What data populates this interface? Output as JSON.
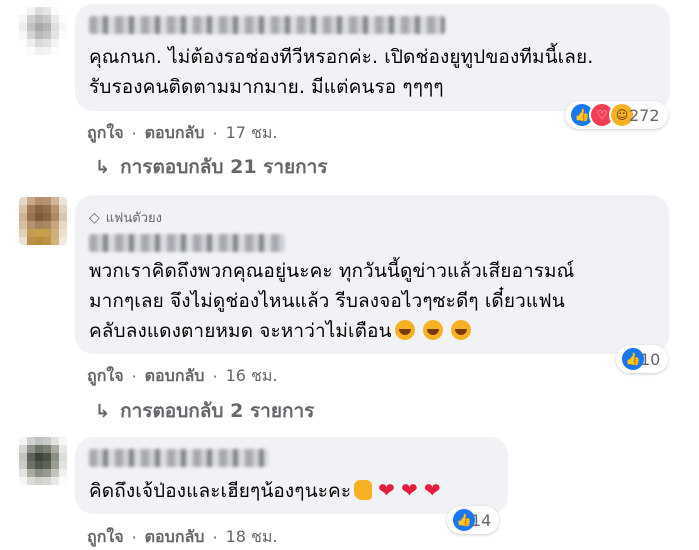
{
  "comments": [
    {
      "text": "คุณกนก. ไม่ต้องรอช่องทีวีหรอกค่ะ. เปิดช่องยูทูปของทีมนี้เลย.\nรับรองคนติดตามมากมาย. มีแต่คนรอ ๆๆๆๆ",
      "reactions": {
        "icons": [
          "like-icon",
          "love-icon",
          "haha-icon"
        ],
        "count": "272"
      },
      "like_label": "ถูกใจ",
      "reply_label": "ตอบกลับ",
      "time": "17 ชม.",
      "replies_label": "การตอบกลับ 21 รายการ"
    },
    {
      "badge": "แฟนตัวยง",
      "text": "พวกเราคิดถึงพวกคุณอยู่นะคะ ทุกวันนี้ดูข่าวแล้วเสียอารมณ์\nมากๆเลย จึงไม่ดูช่องไหนแล้ว รีบลงจอไวๆซะดีๆ เดี๋ยวแฟน\nคลับลงแดงตายหมด จะหาว่าไม่เตือน",
      "reactions": {
        "icons": [
          "like-icon"
        ],
        "count": "10"
      },
      "like_label": "ถูกใจ",
      "reply_label": "ตอบกลับ",
      "time": "16 ชม.",
      "replies_label": "การตอบกลับ 2 รายการ"
    },
    {
      "text": "คิดถึงเจ้ป่องและเฮียๆน้องๆนะคะ",
      "reactions": {
        "icons": [
          "like-icon"
        ],
        "count": "14"
      },
      "like_label": "ถูกใจ",
      "reply_label": "ตอบกลับ",
      "time": "18 ชม."
    }
  ],
  "colors": {
    "bubble": "#f0f2f5",
    "muted_text": "#65676b",
    "like_blue": "#1877f2",
    "love_red": "#f33e58",
    "haha_yellow": "#f7b125"
  }
}
